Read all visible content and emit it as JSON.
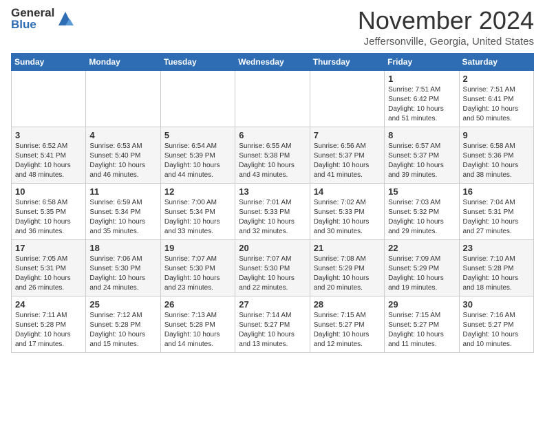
{
  "logo": {
    "general": "General",
    "blue": "Blue"
  },
  "header": {
    "month": "November 2024",
    "location": "Jeffersonville, Georgia, United States"
  },
  "weekdays": [
    "Sunday",
    "Monday",
    "Tuesday",
    "Wednesday",
    "Thursday",
    "Friday",
    "Saturday"
  ],
  "weeks": [
    [
      null,
      null,
      null,
      null,
      null,
      {
        "day": 1,
        "sunrise": "7:51 AM",
        "sunset": "6:42 PM",
        "daylight": "10 hours and 51 minutes."
      },
      {
        "day": 2,
        "sunrise": "7:51 AM",
        "sunset": "6:41 PM",
        "daylight": "10 hours and 50 minutes."
      }
    ],
    [
      {
        "day": 3,
        "sunrise": "6:52 AM",
        "sunset": "5:41 PM",
        "daylight": "10 hours and 48 minutes."
      },
      {
        "day": 4,
        "sunrise": "6:53 AM",
        "sunset": "5:40 PM",
        "daylight": "10 hours and 46 minutes."
      },
      {
        "day": 5,
        "sunrise": "6:54 AM",
        "sunset": "5:39 PM",
        "daylight": "10 hours and 44 minutes."
      },
      {
        "day": 6,
        "sunrise": "6:55 AM",
        "sunset": "5:38 PM",
        "daylight": "10 hours and 43 minutes."
      },
      {
        "day": 7,
        "sunrise": "6:56 AM",
        "sunset": "5:37 PM",
        "daylight": "10 hours and 41 minutes."
      },
      {
        "day": 8,
        "sunrise": "6:57 AM",
        "sunset": "5:37 PM",
        "daylight": "10 hours and 39 minutes."
      },
      {
        "day": 9,
        "sunrise": "6:58 AM",
        "sunset": "5:36 PM",
        "daylight": "10 hours and 38 minutes."
      }
    ],
    [
      {
        "day": 10,
        "sunrise": "6:58 AM",
        "sunset": "5:35 PM",
        "daylight": "10 hours and 36 minutes."
      },
      {
        "day": 11,
        "sunrise": "6:59 AM",
        "sunset": "5:34 PM",
        "daylight": "10 hours and 35 minutes."
      },
      {
        "day": 12,
        "sunrise": "7:00 AM",
        "sunset": "5:34 PM",
        "daylight": "10 hours and 33 minutes."
      },
      {
        "day": 13,
        "sunrise": "7:01 AM",
        "sunset": "5:33 PM",
        "daylight": "10 hours and 32 minutes."
      },
      {
        "day": 14,
        "sunrise": "7:02 AM",
        "sunset": "5:33 PM",
        "daylight": "10 hours and 30 minutes."
      },
      {
        "day": 15,
        "sunrise": "7:03 AM",
        "sunset": "5:32 PM",
        "daylight": "10 hours and 29 minutes."
      },
      {
        "day": 16,
        "sunrise": "7:04 AM",
        "sunset": "5:31 PM",
        "daylight": "10 hours and 27 minutes."
      }
    ],
    [
      {
        "day": 17,
        "sunrise": "7:05 AM",
        "sunset": "5:31 PM",
        "daylight": "10 hours and 26 minutes."
      },
      {
        "day": 18,
        "sunrise": "7:06 AM",
        "sunset": "5:30 PM",
        "daylight": "10 hours and 24 minutes."
      },
      {
        "day": 19,
        "sunrise": "7:07 AM",
        "sunset": "5:30 PM",
        "daylight": "10 hours and 23 minutes."
      },
      {
        "day": 20,
        "sunrise": "7:07 AM",
        "sunset": "5:30 PM",
        "daylight": "10 hours and 22 minutes."
      },
      {
        "day": 21,
        "sunrise": "7:08 AM",
        "sunset": "5:29 PM",
        "daylight": "10 hours and 20 minutes."
      },
      {
        "day": 22,
        "sunrise": "7:09 AM",
        "sunset": "5:29 PM",
        "daylight": "10 hours and 19 minutes."
      },
      {
        "day": 23,
        "sunrise": "7:10 AM",
        "sunset": "5:28 PM",
        "daylight": "10 hours and 18 minutes."
      }
    ],
    [
      {
        "day": 24,
        "sunrise": "7:11 AM",
        "sunset": "5:28 PM",
        "daylight": "10 hours and 17 minutes."
      },
      {
        "day": 25,
        "sunrise": "7:12 AM",
        "sunset": "5:28 PM",
        "daylight": "10 hours and 15 minutes."
      },
      {
        "day": 26,
        "sunrise": "7:13 AM",
        "sunset": "5:28 PM",
        "daylight": "10 hours and 14 minutes."
      },
      {
        "day": 27,
        "sunrise": "7:14 AM",
        "sunset": "5:27 PM",
        "daylight": "10 hours and 13 minutes."
      },
      {
        "day": 28,
        "sunrise": "7:15 AM",
        "sunset": "5:27 PM",
        "daylight": "10 hours and 12 minutes."
      },
      {
        "day": 29,
        "sunrise": "7:15 AM",
        "sunset": "5:27 PM",
        "daylight": "10 hours and 11 minutes."
      },
      {
        "day": 30,
        "sunrise": "7:16 AM",
        "sunset": "5:27 PM",
        "daylight": "10 hours and 10 minutes."
      }
    ]
  ]
}
